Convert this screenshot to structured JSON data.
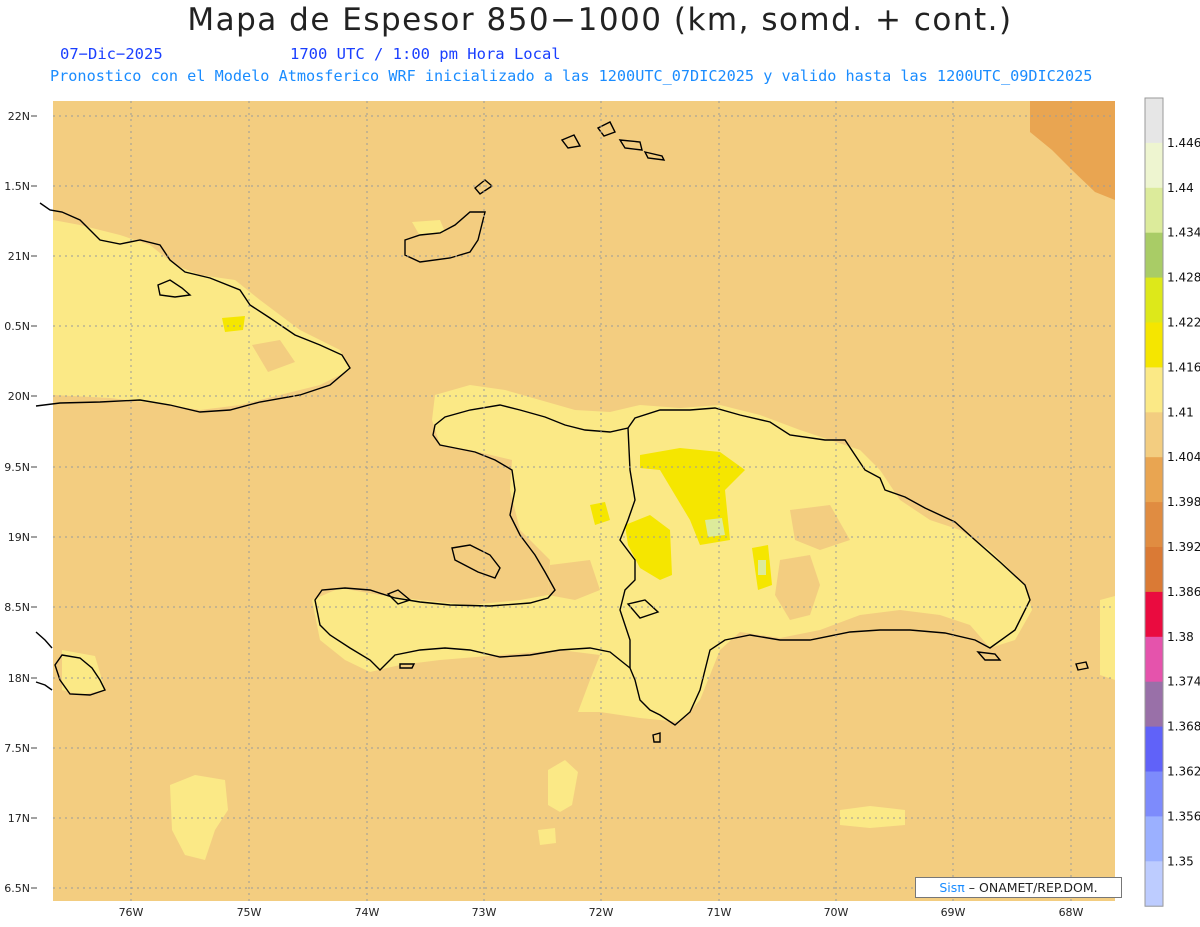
{
  "header": {
    "title": "Mapa de Espesor 850−1000 (km, somd. + cont.)",
    "date": "07−Dic−2025",
    "time": "1700 UTC / 1:00 pm Hora Local",
    "info": "Pronostico con el Modelo Atmosferico WRF inicializado a las 1200UTC_07DIC2025 y valido hasta las  1200UTC_09DIC2025"
  },
  "map": {
    "lat_ticks": [
      "22N",
      "1.5N",
      "21N",
      "0.5N",
      "20N",
      "9.5N",
      "19N",
      "8.5N",
      "18N",
      "7.5N",
      "17N",
      "6.5N"
    ],
    "lon_ticks": [
      "76W",
      "75W",
      "74W",
      "73W",
      "72W",
      "71W",
      "70W",
      "69W",
      "68W"
    ],
    "region": "Hispaniola, eastern Cuba, Jamaica and the Bahamas",
    "grid": "dotted"
  },
  "colorbar": {
    "labels": [
      "1.446",
      "1.44",
      "1.434",
      "1.428",
      "1.422",
      "1.416",
      "1.41",
      "1.404",
      "1.398",
      "1.392",
      "1.386",
      "1.38",
      "1.374",
      "1.368",
      "1.362",
      "1.356",
      "1.35"
    ],
    "colors": [
      "#e6e6e6",
      "#eef5d0",
      "#dceb9b",
      "#a9cc66",
      "#dde81a",
      "#f5e600",
      "#fbe986",
      "#f3cd80",
      "#e9a551",
      "#e08c41",
      "#da7a35",
      "#ea0b3f",
      "#e553ac",
      "#9970a8",
      "#6062f9",
      "#7d8bfc",
      "#9bb0ff",
      "#bdccff"
    ]
  },
  "legend_colors": {
    "ocean": "#f3cd80",
    "land": "#fbe986",
    "warm": "#e9a551",
    "hot": "#f5e600",
    "coast": "#000000"
  },
  "credit": {
    "sis": "Sisπ",
    "rest": "– ONAMET/REP.DOM."
  }
}
